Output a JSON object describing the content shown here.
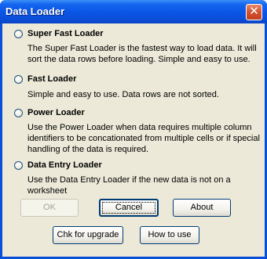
{
  "window": {
    "title": "Data Loader",
    "close_icon": "close-x-icon"
  },
  "options": [
    {
      "label": "Super Fast Loader",
      "selected": false,
      "description": "The Super Fast Loader is the fastest way to load data.  It will sort the data rows before loading. Simple and easy to use."
    },
    {
      "label": "Fast Loader",
      "selected": false,
      "description": "Simple and easy to use. Data rows are not sorted."
    },
    {
      "label": "Power Loader",
      "selected": false,
      "description": "Use the Power Loader when data requires multiple column identifiers to be concationated from multiple cells or if special handling of the data is required."
    },
    {
      "label": "Data Entry Loader",
      "selected": false,
      "description": "Use the Data Entry Loader if the new data is not on a worksheet"
    }
  ],
  "buttons": {
    "ok": "OK",
    "cancel": "Cancel",
    "about": "About",
    "upgrade": "Chk for upgrade",
    "howto": "How to use"
  },
  "colors": {
    "titlebar": "#0a56e6",
    "client_bg": "#ece9d8",
    "close_button": "#d2522f"
  }
}
